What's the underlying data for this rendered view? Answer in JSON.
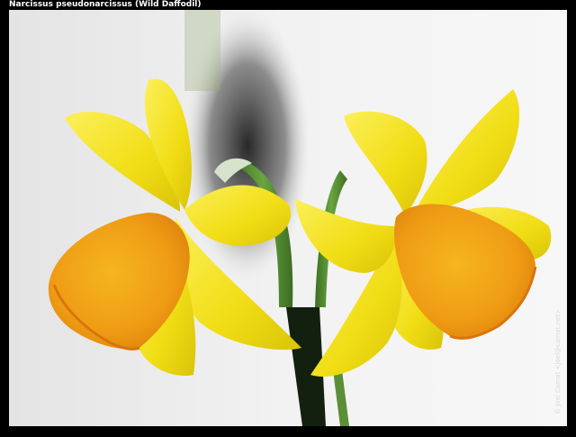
{
  "caption": "Narcissus pseudonarcissus (Wild Daffodil)",
  "watermark": "© Joel Carnat <joel@carnat.net>",
  "colors": {
    "background": "#efefef",
    "frame": "#000000",
    "petal": "#f3e21c",
    "trumpet": "#f0a417",
    "stem": "#4f8a2f"
  }
}
